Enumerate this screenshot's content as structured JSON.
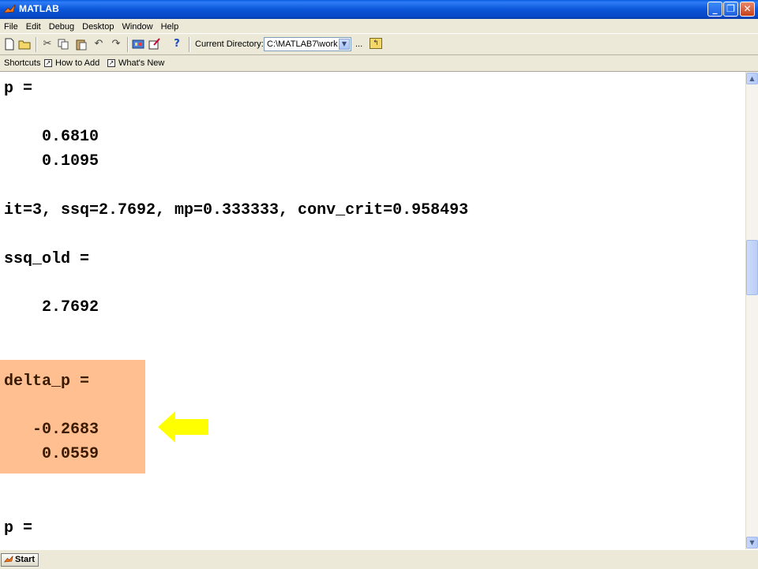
{
  "window": {
    "title": "MATLAB",
    "buttons": {
      "minimize": "_",
      "maximize": "❐",
      "close": "✕"
    }
  },
  "menu": [
    "File",
    "Edit",
    "Debug",
    "Desktop",
    "Window",
    "Help"
  ],
  "toolbar": {
    "current_directory_label": "Current Directory:",
    "current_directory_value": "C:\\MATLAB7\\work",
    "browse_label": "..."
  },
  "shortcuts": {
    "label": "Shortcuts",
    "items": [
      "How to Add",
      "What's New"
    ]
  },
  "command_window": {
    "lines": [
      "p =",
      "",
      "    0.6810",
      "    0.1095",
      "",
      "it=3, ssq=2.7692, mp=0.333333, conv_crit=0.958493",
      "",
      "ssq_old =",
      "",
      "    2.7692",
      "",
      "",
      "delta_p =",
      "",
      "   -0.2683",
      "    0.0559",
      "",
      "",
      "p ="
    ],
    "highlight_color": "#ffbf90",
    "arrow_color": "#ffff00"
  },
  "status": {
    "start_label": "Start"
  }
}
